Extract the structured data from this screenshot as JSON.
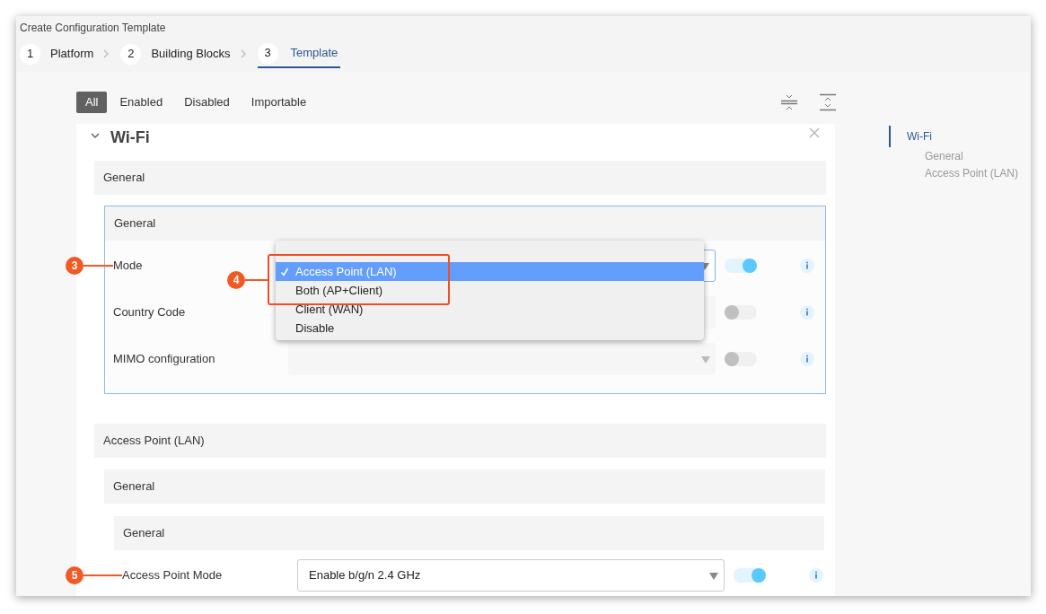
{
  "window": {
    "title": "Create Configuration Template"
  },
  "steps": [
    {
      "number": "1",
      "label": "Platform",
      "selected": false
    },
    {
      "number": "2",
      "label": "Building Blocks",
      "selected": false
    },
    {
      "number": "3",
      "label": "Template",
      "selected": true
    }
  ],
  "filters": [
    {
      "label": "All",
      "selected": true
    },
    {
      "label": "Enabled",
      "selected": false
    },
    {
      "label": "Disabled",
      "selected": false
    },
    {
      "label": "Importable",
      "selected": false
    }
  ],
  "card": {
    "title": "Wi-Fi",
    "expanded": true,
    "general_section": {
      "title": "General",
      "group": {
        "title": "General",
        "rows": [
          {
            "label": "Mode",
            "value": "",
            "arrow": true,
            "on": true,
            "focused": true,
            "callout": "3"
          },
          {
            "label": "Country Code",
            "value": "",
            "arrow": false,
            "on": false,
            "focused": false
          },
          {
            "label": "MIMO configuration",
            "value": "",
            "arrow": true,
            "on": false,
            "focused": false
          }
        ]
      },
      "dropdown": {
        "callout": "4",
        "options": [
          {
            "label": "Access Point (LAN)",
            "selected": true
          },
          {
            "label": "Both (AP+Client)",
            "selected": false
          },
          {
            "label": "Client (WAN)",
            "selected": false
          },
          {
            "label": "Disable",
            "selected": false
          }
        ]
      }
    },
    "ap_section": {
      "title": "Access Point (LAN)",
      "subsection": {
        "title": "General",
        "group": {
          "title": "General",
          "rows": [
            {
              "label": "Access Point Mode",
              "value": "Enable b/g/n 2.4 GHz",
              "arrow": true,
              "on": true,
              "focused": false,
              "callout": "5"
            }
          ]
        }
      }
    }
  },
  "outline": {
    "items": [
      {
        "label": "Wi-Fi",
        "selected": true,
        "children": [
          {
            "label": "General"
          },
          {
            "label": "Access Point (LAN)"
          }
        ]
      }
    ]
  }
}
